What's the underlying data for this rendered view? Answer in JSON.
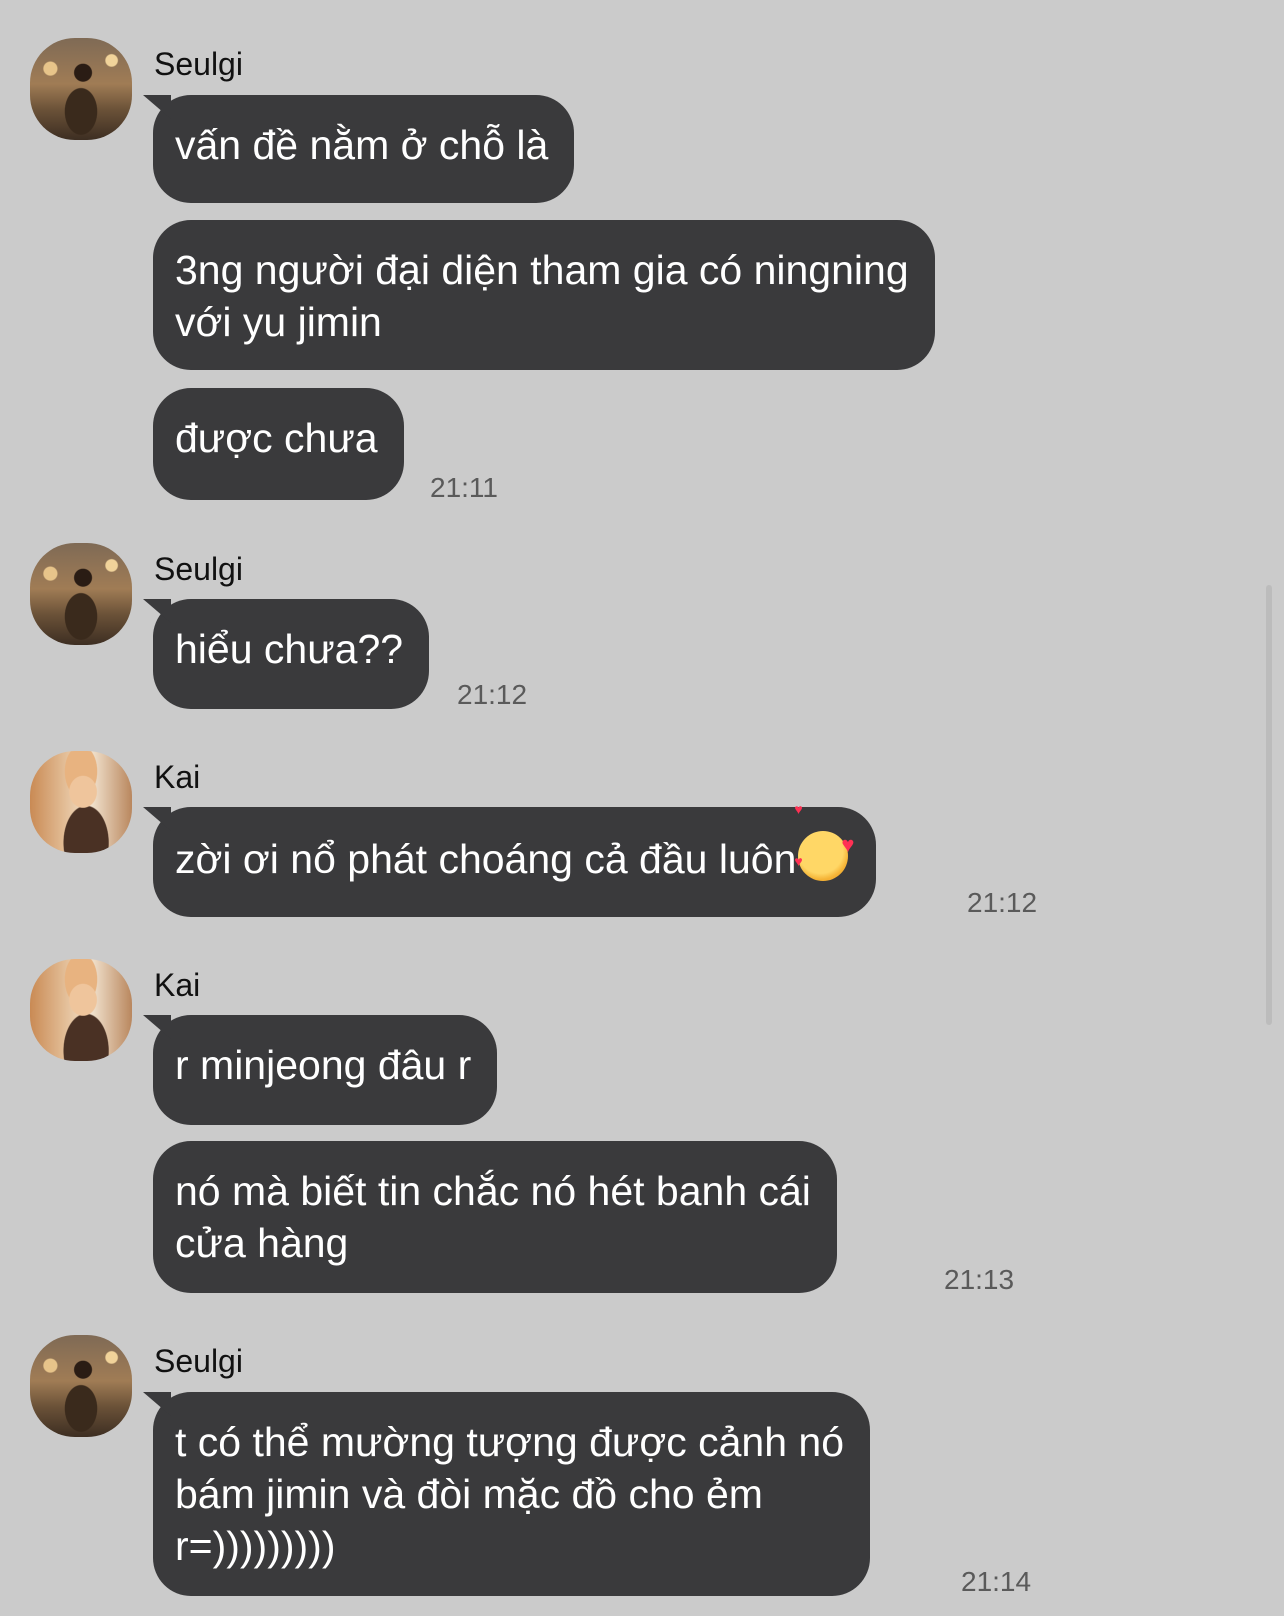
{
  "messages": [
    {
      "sender": "Seulgi",
      "bubbles": [
        "vấn đề nằm ở chỗ là",
        "3ng người đại diện tham gia có ningning\nvới yu jimin",
        "được chưa"
      ],
      "time": "21:11"
    },
    {
      "sender": "Seulgi",
      "bubbles": [
        "hiểu chưa??"
      ],
      "time": "21:12"
    },
    {
      "sender": "Kai",
      "bubbles": [
        "zời ơi nổ phát choáng cả đầu luôn"
      ],
      "emoji": "smiling-face-with-hearts",
      "time": "21:12"
    },
    {
      "sender": "Kai",
      "bubbles": [
        "r minjeong đâu r",
        "nó mà biết tin chắc nó hét banh cái\ncửa hàng"
      ],
      "time": "21:13"
    },
    {
      "sender": "Seulgi",
      "bubbles": [
        "t có thể mường tượng được cảnh nó\nbám jimin và đòi mặc đồ cho ẻm\nr=)))))))))"
      ],
      "time": "21:14"
    }
  ],
  "colors": {
    "background": "#cbcbcb",
    "bubble": "#3a3a3c",
    "bubble_text": "#ffffff",
    "time_text": "#5a5a5a"
  }
}
